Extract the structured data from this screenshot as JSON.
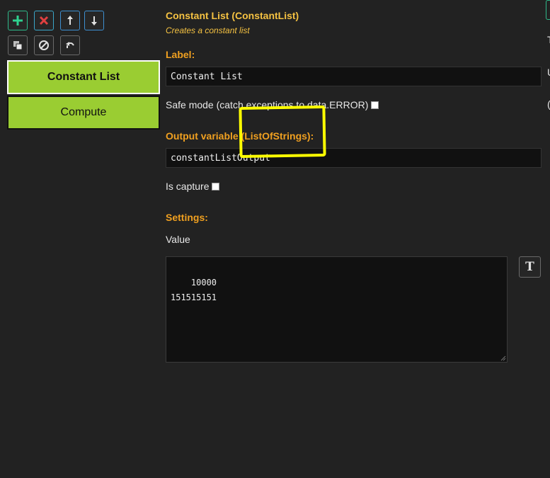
{
  "toolbar": {
    "add": "add-icon",
    "delete": "close-icon",
    "move_up": "arrow-up-icon",
    "move_down": "arrow-down-icon",
    "duplicate": "duplicate-icon",
    "disable": "disable-icon",
    "undo": "undo-icon"
  },
  "blocks": [
    {
      "label": "Constant List",
      "selected": true
    },
    {
      "label": "Compute",
      "selected": false
    }
  ],
  "panel": {
    "title": "Constant List (ConstantList)",
    "subtitle": "Creates a constant list",
    "label_heading": "Label:",
    "label_value": "Constant List",
    "safe_mode_label": "Safe mode (catch exceptions to data.ERROR)",
    "output_heading": "Output variable (ListOfStrings):",
    "output_value": "constantListOutput",
    "capture_label": "Is capture",
    "settings_heading": "Settings:",
    "value_label": "Value",
    "value_text": "10000\n151515151",
    "format_button_label": "T"
  },
  "edge": {
    "chars": [
      "T",
      "U",
      "("
    ]
  },
  "colors": {
    "background": "#222222",
    "block": "#9acd32",
    "heading": "#f0a020",
    "title": "#f5c242",
    "highlight": "#ffff00"
  }
}
